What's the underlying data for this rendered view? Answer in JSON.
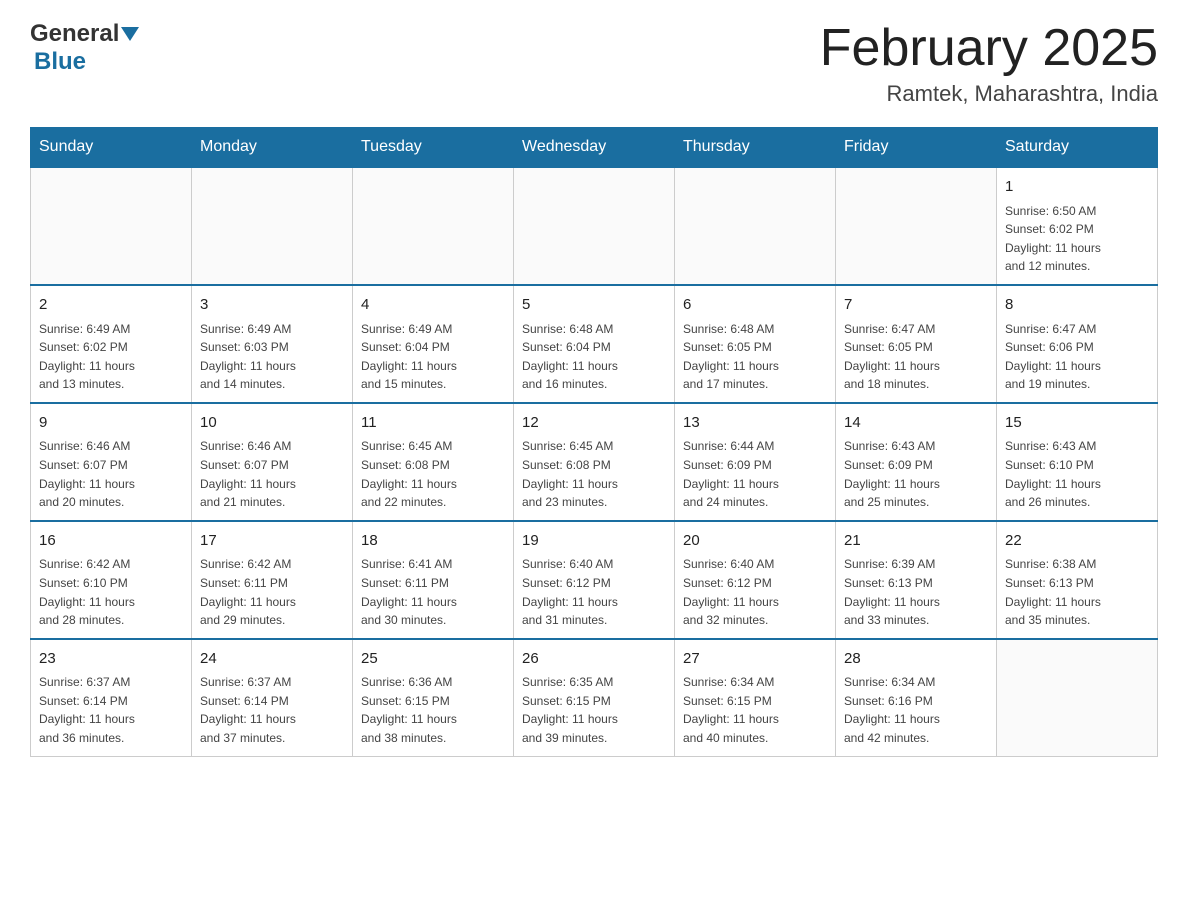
{
  "header": {
    "logo_general": "General",
    "logo_blue": "Blue",
    "title": "February 2025",
    "subtitle": "Ramtek, Maharashtra, India"
  },
  "days_of_week": [
    "Sunday",
    "Monday",
    "Tuesday",
    "Wednesday",
    "Thursday",
    "Friday",
    "Saturday"
  ],
  "weeks": [
    [
      {
        "day": "",
        "info": ""
      },
      {
        "day": "",
        "info": ""
      },
      {
        "day": "",
        "info": ""
      },
      {
        "day": "",
        "info": ""
      },
      {
        "day": "",
        "info": ""
      },
      {
        "day": "",
        "info": ""
      },
      {
        "day": "1",
        "info": "Sunrise: 6:50 AM\nSunset: 6:02 PM\nDaylight: 11 hours\nand 12 minutes."
      }
    ],
    [
      {
        "day": "2",
        "info": "Sunrise: 6:49 AM\nSunset: 6:02 PM\nDaylight: 11 hours\nand 13 minutes."
      },
      {
        "day": "3",
        "info": "Sunrise: 6:49 AM\nSunset: 6:03 PM\nDaylight: 11 hours\nand 14 minutes."
      },
      {
        "day": "4",
        "info": "Sunrise: 6:49 AM\nSunset: 6:04 PM\nDaylight: 11 hours\nand 15 minutes."
      },
      {
        "day": "5",
        "info": "Sunrise: 6:48 AM\nSunset: 6:04 PM\nDaylight: 11 hours\nand 16 minutes."
      },
      {
        "day": "6",
        "info": "Sunrise: 6:48 AM\nSunset: 6:05 PM\nDaylight: 11 hours\nand 17 minutes."
      },
      {
        "day": "7",
        "info": "Sunrise: 6:47 AM\nSunset: 6:05 PM\nDaylight: 11 hours\nand 18 minutes."
      },
      {
        "day": "8",
        "info": "Sunrise: 6:47 AM\nSunset: 6:06 PM\nDaylight: 11 hours\nand 19 minutes."
      }
    ],
    [
      {
        "day": "9",
        "info": "Sunrise: 6:46 AM\nSunset: 6:07 PM\nDaylight: 11 hours\nand 20 minutes."
      },
      {
        "day": "10",
        "info": "Sunrise: 6:46 AM\nSunset: 6:07 PM\nDaylight: 11 hours\nand 21 minutes."
      },
      {
        "day": "11",
        "info": "Sunrise: 6:45 AM\nSunset: 6:08 PM\nDaylight: 11 hours\nand 22 minutes."
      },
      {
        "day": "12",
        "info": "Sunrise: 6:45 AM\nSunset: 6:08 PM\nDaylight: 11 hours\nand 23 minutes."
      },
      {
        "day": "13",
        "info": "Sunrise: 6:44 AM\nSunset: 6:09 PM\nDaylight: 11 hours\nand 24 minutes."
      },
      {
        "day": "14",
        "info": "Sunrise: 6:43 AM\nSunset: 6:09 PM\nDaylight: 11 hours\nand 25 minutes."
      },
      {
        "day": "15",
        "info": "Sunrise: 6:43 AM\nSunset: 6:10 PM\nDaylight: 11 hours\nand 26 minutes."
      }
    ],
    [
      {
        "day": "16",
        "info": "Sunrise: 6:42 AM\nSunset: 6:10 PM\nDaylight: 11 hours\nand 28 minutes."
      },
      {
        "day": "17",
        "info": "Sunrise: 6:42 AM\nSunset: 6:11 PM\nDaylight: 11 hours\nand 29 minutes."
      },
      {
        "day": "18",
        "info": "Sunrise: 6:41 AM\nSunset: 6:11 PM\nDaylight: 11 hours\nand 30 minutes."
      },
      {
        "day": "19",
        "info": "Sunrise: 6:40 AM\nSunset: 6:12 PM\nDaylight: 11 hours\nand 31 minutes."
      },
      {
        "day": "20",
        "info": "Sunrise: 6:40 AM\nSunset: 6:12 PM\nDaylight: 11 hours\nand 32 minutes."
      },
      {
        "day": "21",
        "info": "Sunrise: 6:39 AM\nSunset: 6:13 PM\nDaylight: 11 hours\nand 33 minutes."
      },
      {
        "day": "22",
        "info": "Sunrise: 6:38 AM\nSunset: 6:13 PM\nDaylight: 11 hours\nand 35 minutes."
      }
    ],
    [
      {
        "day": "23",
        "info": "Sunrise: 6:37 AM\nSunset: 6:14 PM\nDaylight: 11 hours\nand 36 minutes."
      },
      {
        "day": "24",
        "info": "Sunrise: 6:37 AM\nSunset: 6:14 PM\nDaylight: 11 hours\nand 37 minutes."
      },
      {
        "day": "25",
        "info": "Sunrise: 6:36 AM\nSunset: 6:15 PM\nDaylight: 11 hours\nand 38 minutes."
      },
      {
        "day": "26",
        "info": "Sunrise: 6:35 AM\nSunset: 6:15 PM\nDaylight: 11 hours\nand 39 minutes."
      },
      {
        "day": "27",
        "info": "Sunrise: 6:34 AM\nSunset: 6:15 PM\nDaylight: 11 hours\nand 40 minutes."
      },
      {
        "day": "28",
        "info": "Sunrise: 6:34 AM\nSunset: 6:16 PM\nDaylight: 11 hours\nand 42 minutes."
      },
      {
        "day": "",
        "info": ""
      }
    ]
  ]
}
